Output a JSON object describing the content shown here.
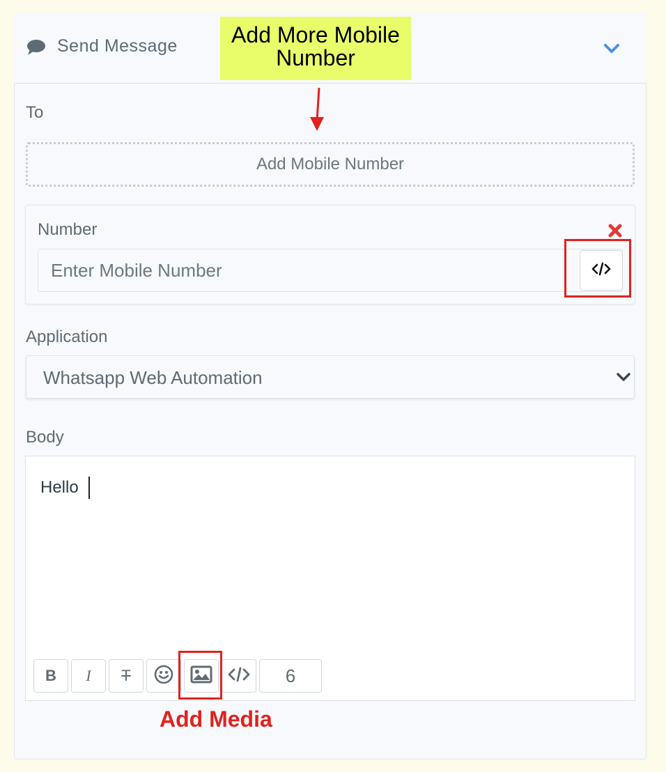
{
  "header": {
    "title": "Send Message"
  },
  "annotations": {
    "add_more_mobile": "Add More Mobile Number",
    "add_media": "Add Media"
  },
  "to": {
    "label": "To",
    "add_mobile_label": "Add Mobile Number"
  },
  "number": {
    "label": "Number",
    "placeholder": "Enter Mobile Number",
    "value": ""
  },
  "application": {
    "label": "Application",
    "selected": "Whatsapp Web Automation"
  },
  "body": {
    "label": "Body",
    "text": "Hello"
  },
  "toolbar": {
    "bold": "B",
    "italic": "I",
    "strike": "T",
    "counter": "6"
  },
  "colors": {
    "accent_blue": "#4a90e2",
    "remove_red": "#e53935",
    "annotation_red": "#e0221e",
    "annotation_yellow": "#e9fd6b"
  }
}
